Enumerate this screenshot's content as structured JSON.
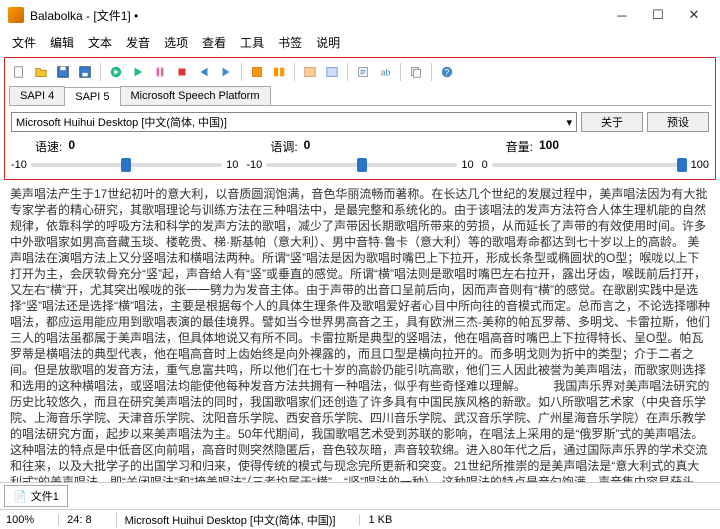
{
  "window": {
    "title": "Balabolka - [文件1] •"
  },
  "menu": {
    "items": [
      "文件",
      "编辑",
      "文本",
      "发音",
      "选项",
      "查看",
      "工具",
      "书签",
      "说明"
    ]
  },
  "tabs": {
    "items": [
      "SAPI 4",
      "SAPI 5",
      "Microsoft Speech Platform"
    ],
    "active": 1
  },
  "voice": {
    "selected": "Microsoft Huihui Desktop [中文(简体, 中国)]"
  },
  "buttons": {
    "about": "关于",
    "preset": "预设"
  },
  "sliders": {
    "rate": {
      "label": "语速:",
      "value": "0",
      "min": "-10",
      "max": "10"
    },
    "pitch": {
      "label": "语调:",
      "value": "0",
      "min": "-10",
      "max": "10"
    },
    "volume": {
      "label": "音量:",
      "value": "100",
      "min": "0",
      "max": "100"
    }
  },
  "content": "美声唱法产生于17世纪初叶的意大利，以音质圆润饱满，音色华丽流畅而著称。在长达几个世纪的发展过程中，美声唱法因为有大批专家学者的精心研究，其歌唱理论与训练方法在三种唱法中，是最完整和系统化的。由于该唱法的发声方法符合人体生理机能的自然规律，依靠科学的呼吸方法和科学的发声方法的歌唱，减少了声带因长期歌唱所带来的劳损，从而延长了声带的有效使用时间。许多中外歌唱家如男高音藏玉琰、楼乾贵、梯·斯基帕（意大利）、男中音特·鲁卡（意大利）等的歌唱寿命都达到七十岁以上的高龄。\n美声唱法在演唱方法上又分竖唱法和横唱法两种。所谓“竖”唱法是因为歌唱时嘴巴上下拉开，形成长条型或椭圆状的O型；喉咙以上下打开为主，会厌软骨充分“竖”起，声音给人有“竖”或垂直的感觉。所谓“横”唱法则是歌唱时嘴巴左右拉开，露出牙齿，喉既前后打开，又左右“横”开，尤其突出喉咙的张一一劈力为发音主体。由于声带的出音口呈前后向，因而声音则有“横”的感觉。在歌剧实践中是选择“竖”唱法还是选择“横”唱法，主要是根据每个人的具体生理条件及歌唱爱好者心目中所向往的音模式而定。总而言之，不论选择哪种唱法，都应运用能应用到歌唱表演的最佳境界。譬如当今世界男高音之王，具有欧洲三杰-美称的帕瓦罗蒂、多明戈、卡雷拉斯，他们三人的唱法虽都属于美声唱法，但具体地说又有所不同。卡雷拉斯是典型的竖唱法，他在唱高音时嘴巴上下拉得特长、呈O型。帕瓦罗蒂是横唱法的典型代表，他在唱高音时上齿始终是向外裸露的，而且口型是横向拉开的。而多明戈则为折中的类型；介于二者之间。但是放歌唱的发音方法，重气息富共鸣，所以他们在七十岁的高龄仍能引吭高歌，他们三人因此被誉为美声唱法，而歌家则选择和选用的这种横唱法，或竖唱法均能使他每种发音方法共拥有一种唱法，似乎有些奇怪难以理解。\n　　我国声乐界对美声唱法研究的历史比较悠久，而且在研究美声唱法的同时，我国歌唱家们还创造了许多具有中国民族风格的新歌。如八所歌唱艺术家（中央音乐学院、上海音乐学院、天津音乐学院、沈阳音乐学院、西安音乐学院、四川音乐学院、武汉音乐学院、广州星海音乐学院）在声乐教学的唱法研究方面，起步以来美声唱法为主。50年代期间，我国歌唱艺术受到苏联的影响，在唱法上采用的是“俄罗斯”式的美声唱法。这种唱法的特点是中低音区向前唱，高音时则突然隐匿后，音色较灰暗，声音较软绵。进入80年代之后，通过国际声乐界的学术交流和往来，以及大批学子的出国学习和归来，使得传统的模式与现念完所更新和突变。21世纪所推崇的是美声唱法是“意大利式的真大利式”的美声唱法。即“关闭唱法”和“掩盖唱法”（三者均属于“横”、“竖”唱法的一种）。这种唱法的特点是音匀饱满、声音集中容易获头声，音量较大、同时，吐字也较方便。但总的，习掌握和运用好这种唱法，是我国歌唱艺术逐渐世界化及接续世界美声唱法正在与向国际接轨中的有力保证。\n　　我国著名美声唱法的歌唱家中，男高音有施鸿鄂、王凯平、程志、刘维维、杨洪基、顾欣；女高音有吴其辉等；女高音有周小燕、张权、郭淑珍、孙家馨、梁宁、迪里拜尔、殷秀梅、郑莉、李玲玉、李丹阳等；女中音有林灿、范究版杨比娅、关牧村、董方济慧等。他们的优秀保留曲目有《玛依拉桂花开》、《松花江上》、《延安颂》、《黄河颂》、《美丽的心灵》、《大海啊、故乡》、《珍珠湖》、《吐鲁番的葡萄熟了》、《沧花曲》等；其次，在演唱形式上美声唱法还有最更纯和最正统传统中的如声乐如组曲、独唱、小合唱（包括男声小合唱、女声小合唱）、男声四重唱、二重唱（包括男声二重唱、女声二重唱、男女声对唱）、独唱等多种形式。另外，美声唱法还具有音质圆润饱满，音色华丽流畅，音域宽广、声音冰凉空灵又有空气感等特点。",
  "filetab": {
    "name": "文件1"
  },
  "status": {
    "zoom": "100%",
    "pos": "24:  8",
    "voice": "Microsoft Huihui Desktop [中文(简体, 中国)]",
    "size": "1 KB"
  }
}
